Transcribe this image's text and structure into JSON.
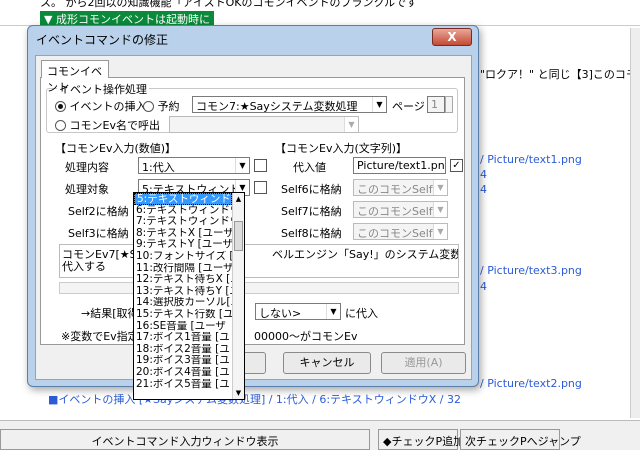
{
  "background": {
    "top_line1": "ス。   から2回以の知識機能「アイストOKのコモンイベントのブランクルです",
    "top_line2": "▼ 成形コモンイベントは起動時に",
    "right_frag1": "\"ロクア！\" と同じ【3]このコモンEv1",
    "path1": "/ Picture/text1.png",
    "num_a": "4",
    "num_b": "4",
    "path2": "/ Picture/text3.png",
    "num_c": "4",
    "path3": "/ Picture/text2.png",
    "bottom_line1": "■イベントの挿入 [★Sayシステム変数処理] / 1:代入 / 6:テキストウィンドウX / 32",
    "bottom_label": "イベントコマンド入力ウィンドウ表示",
    "check_btn": "◆チェックP追加",
    "next_btn": "次チェックPへジャンプ"
  },
  "dialog": {
    "title": "イベントコマンドの修正",
    "close_label": "X",
    "tab": "コモンイベント",
    "group_ops": "イベント操作処理",
    "radio_insert": "イベントの挿入",
    "radio_reserve": "予約",
    "common_select": "コモン7:★Sayシステム変数処理",
    "page_label": "ページ",
    "page_value": "1",
    "radio_call_name": "コモンEv名で呼出",
    "num_input_label": "【コモンEv入力(数値)】",
    "str_input_label": "【コモンEv入力(文字列)】",
    "proc_label": "処理内容",
    "proc_value": "1:代入",
    "target_label": "処理対象",
    "target_value": "5:テキストウィンドウ",
    "self2_label": "Self2に格納",
    "self3_label": "Self3に格納",
    "assign_label": "代入値",
    "assign_value": "Picture/text1.png",
    "self6_label": "Self6に格納",
    "self6_value": "このコモンSelf5",
    "self7_label": "Self7に格納",
    "self7_value": "このコモンSelf5",
    "self8_label": "Self8に格納",
    "self8_value": "このコモンSelf5",
    "desc_left": "コモンEv7[★Say",
    "desc_right": "ベルエンジン「Say!」のシステム変数を取得・",
    "desc_line2": "代入する",
    "result_label": "→結果[取得",
    "result_select": "しない>",
    "result_suffix": "に代入",
    "note_left": "※変数でEv指定",
    "note_right": "00000〜がコモンEv",
    "cancel": "キャンセル",
    "apply": "適用(A)"
  },
  "dropdown": {
    "items": [
      "5:テキストウィンドウ",
      "6:テキストウィンドウX",
      "7:テキストウィンドウY",
      "8:テキストX [ユーザ",
      "9:テキストY [ユーザ",
      "10:フォントサイズ [ユ",
      "11:改行間隔 [ユーザ",
      "12:テキスト待ちX [ユ",
      "13:テキスト待ちY [ユ",
      "14:選択肢カーソル[ユ",
      "15:テキスト行数 [ユ",
      "16:SE音量 [ユーザ",
      "17:ボイス1音量 [ユ",
      "18:ボイス2音量 [ユ",
      "19:ボイス3音量 [ユ",
      "20:ボイス4音量 [ユ",
      "21:ボイス5音量 [ユ"
    ],
    "selected_index": 0
  }
}
